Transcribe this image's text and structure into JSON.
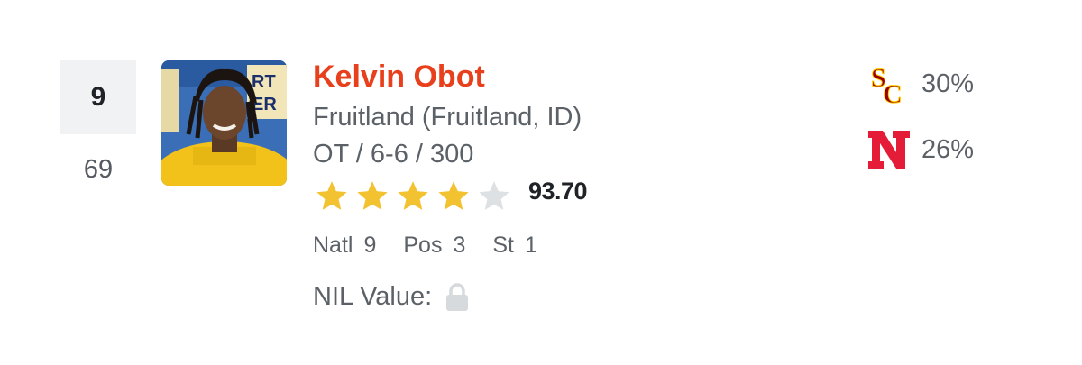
{
  "player": {
    "rank": "9",
    "previous_rank": "69",
    "name": "Kelvin Obot",
    "school": "Fruitland (Fruitland, ID)",
    "position_line": "OT / 6-6 / 300",
    "stars_filled": 4,
    "stars_total": 5,
    "rating": "93.70",
    "rankings": {
      "natl_label": "Natl",
      "natl_value": "9",
      "pos_label": "Pos",
      "pos_value": "3",
      "st_label": "St",
      "st_value": "1"
    },
    "nil_label": "NIL Value:",
    "nil_icon": "lock-icon"
  },
  "predictions": [
    {
      "team_icon": "usc-logo",
      "percent": "30%",
      "color": "#990000",
      "accent": "#ffcc00"
    },
    {
      "team_icon": "nebraska-logo",
      "percent": "26%",
      "color": "#e41c38"
    }
  ],
  "colors": {
    "name": "#e8401c",
    "star_filled": "#f2c230",
    "star_empty": "#dde1e4",
    "rank_box_bg": "#f1f2f4"
  }
}
